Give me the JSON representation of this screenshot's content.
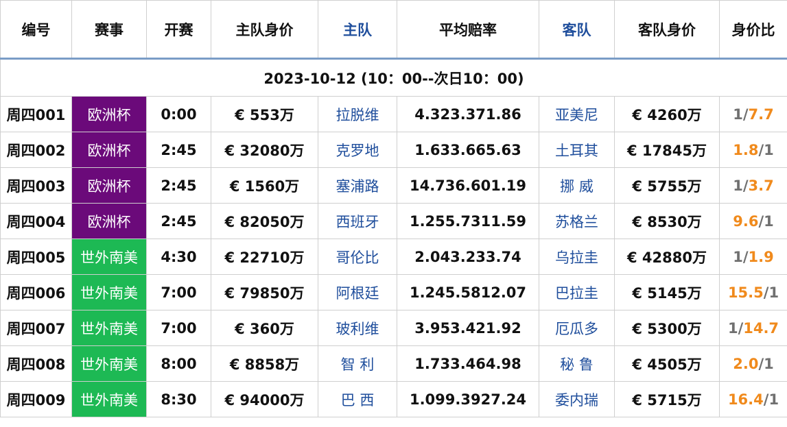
{
  "headers": {
    "code": "编号",
    "comp": "赛事",
    "time": "开赛",
    "home_value": "主队身价",
    "home": "主队",
    "odds": "平均赔率",
    "away": "客队",
    "away_value": "客队身价",
    "ratio": "身价比"
  },
  "date_line": "2023-10-12 (10：00--次日10：00)",
  "colors": {
    "euro_cup": "#6b0a7a",
    "wc_qual_sa": "#1db954",
    "team_blue": "#1f4e9c",
    "ratio_orange": "#f08a1c",
    "ratio_grey": "#707070"
  },
  "rows": [
    {
      "code": "周四001",
      "comp": "欧洲杯",
      "comp_color": "#6b0a7a",
      "time": "0:00",
      "home_value": "€ 553万",
      "home": "拉脱维",
      "odds": "4.323.371.86",
      "away": "亚美尼",
      "away_value": "€ 4260万",
      "ratio_left": "1",
      "ratio_right": "7.7",
      "ratio_high": "right"
    },
    {
      "code": "周四002",
      "comp": "欧洲杯",
      "comp_color": "#6b0a7a",
      "time": "2:45",
      "home_value": "€ 32080万",
      "home": "克罗地",
      "odds": "1.633.665.63",
      "away": "土耳其",
      "away_value": "€ 17845万",
      "ratio_left": "1.8",
      "ratio_right": "1",
      "ratio_high": "left"
    },
    {
      "code": "周四003",
      "comp": "欧洲杯",
      "comp_color": "#6b0a7a",
      "time": "2:45",
      "home_value": "€ 1560万",
      "home": "塞浦路",
      "odds": "14.736.601.19",
      "away": "挪 威",
      "away_value": "€ 5755万",
      "ratio_left": "1",
      "ratio_right": "3.7",
      "ratio_high": "right"
    },
    {
      "code": "周四004",
      "comp": "欧洲杯",
      "comp_color": "#6b0a7a",
      "time": "2:45",
      "home_value": "€ 82050万",
      "home": "西班牙",
      "odds": "1.255.7311.59",
      "away": "苏格兰",
      "away_value": "€ 8530万",
      "ratio_left": "9.6",
      "ratio_right": "1",
      "ratio_high": "left"
    },
    {
      "code": "周四005",
      "comp": "世外南美",
      "comp_color": "#1db954",
      "time": "4:30",
      "home_value": "€ 22710万",
      "home": "哥伦比",
      "odds": "2.043.233.74",
      "away": "乌拉圭",
      "away_value": "€ 42880万",
      "ratio_left": "1",
      "ratio_right": "1.9",
      "ratio_high": "right"
    },
    {
      "code": "周四006",
      "comp": "世外南美",
      "comp_color": "#1db954",
      "time": "7:00",
      "home_value": "€ 79850万",
      "home": "阿根廷",
      "odds": "1.245.5812.07",
      "away": "巴拉圭",
      "away_value": "€ 5145万",
      "ratio_left": "15.5",
      "ratio_right": "1",
      "ratio_high": "left"
    },
    {
      "code": "周四007",
      "comp": "世外南美",
      "comp_color": "#1db954",
      "time": "7:00",
      "home_value": "€ 360万",
      "home": "玻利维",
      "odds": "3.953.421.92",
      "away": "厄瓜多",
      "away_value": "€ 5300万",
      "ratio_left": "1",
      "ratio_right": "14.7",
      "ratio_high": "right"
    },
    {
      "code": "周四008",
      "comp": "世外南美",
      "comp_color": "#1db954",
      "time": "8:00",
      "home_value": "€ 8858万",
      "home": "智 利",
      "odds": "1.733.464.98",
      "away": "秘 鲁",
      "away_value": "€ 4505万",
      "ratio_left": "2.0",
      "ratio_right": "1",
      "ratio_high": "left"
    },
    {
      "code": "周四009",
      "comp": "世外南美",
      "comp_color": "#1db954",
      "time": "8:30",
      "home_value": "€ 94000万",
      "home": "巴 西",
      "odds": "1.099.3927.24",
      "away": "委内瑞",
      "away_value": "€ 5715万",
      "ratio_left": "16.4",
      "ratio_right": "1",
      "ratio_high": "left"
    }
  ]
}
